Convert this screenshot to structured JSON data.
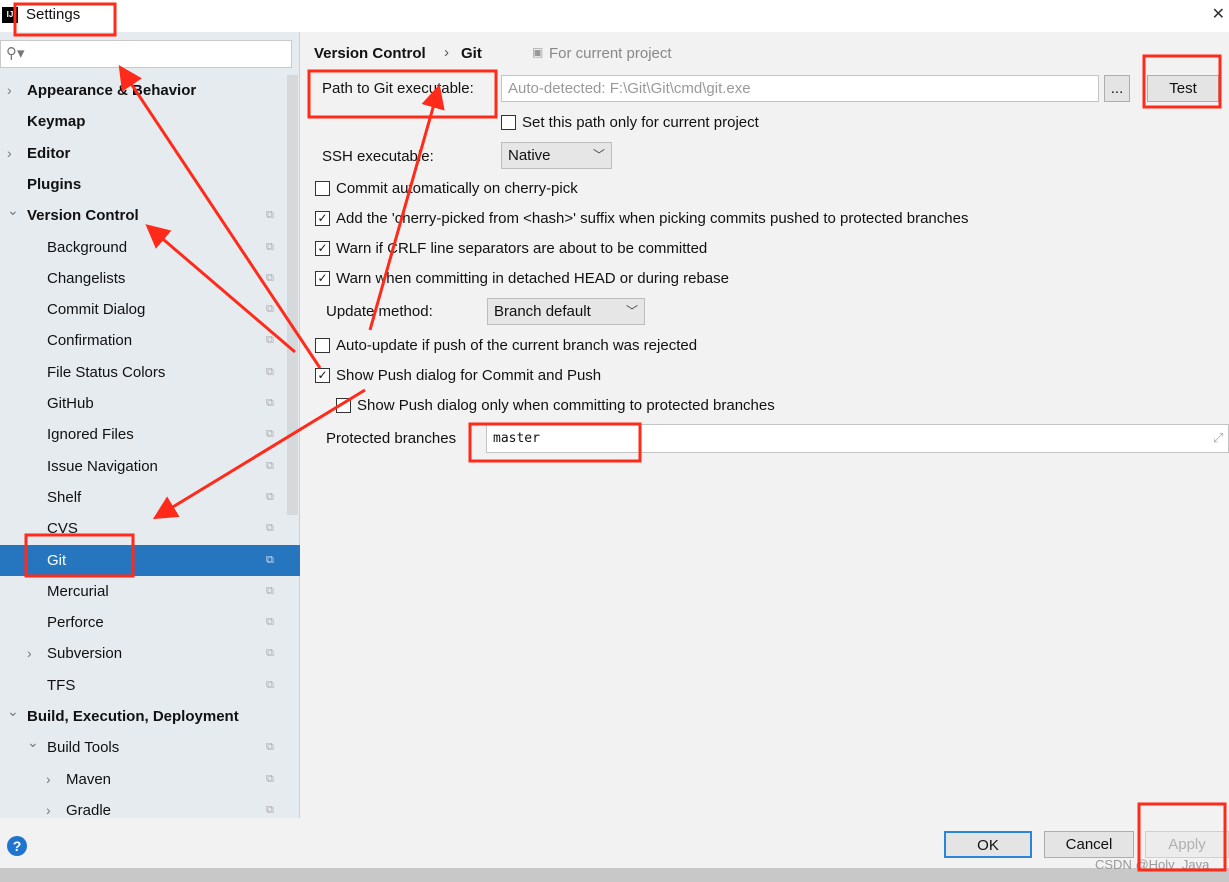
{
  "window": {
    "title": "Settings",
    "close": "✕"
  },
  "sidebar": {
    "search_placeholder": "",
    "items": [
      {
        "label": "Appearance & Behavior",
        "level": 0,
        "bold": true,
        "expandable": true,
        "expanded": false
      },
      {
        "label": "Keymap",
        "level": 0,
        "bold": true
      },
      {
        "label": "Editor",
        "level": 0,
        "bold": true,
        "expandable": true,
        "expanded": false
      },
      {
        "label": "Plugins",
        "level": 0,
        "bold": true
      },
      {
        "label": "Version Control",
        "level": 0,
        "bold": true,
        "expandable": true,
        "expanded": true,
        "copy": true
      },
      {
        "label": "Background",
        "level": 1,
        "copy": true
      },
      {
        "label": "Changelists",
        "level": 1,
        "copy": true
      },
      {
        "label": "Commit Dialog",
        "level": 1,
        "copy": true
      },
      {
        "label": "Confirmation",
        "level": 1,
        "copy": true
      },
      {
        "label": "File Status Colors",
        "level": 1,
        "copy": true
      },
      {
        "label": "GitHub",
        "level": 1,
        "copy": true
      },
      {
        "label": "Ignored Files",
        "level": 1,
        "copy": true
      },
      {
        "label": "Issue Navigation",
        "level": 1,
        "copy": true
      },
      {
        "label": "Shelf",
        "level": 1,
        "copy": true
      },
      {
        "label": "CVS",
        "level": 1,
        "copy": true
      },
      {
        "label": "Git",
        "level": 1,
        "copy": true,
        "selected": true
      },
      {
        "label": "Mercurial",
        "level": 1,
        "copy": true
      },
      {
        "label": "Perforce",
        "level": 1,
        "copy": true
      },
      {
        "label": "Subversion",
        "level": 1,
        "copy": true,
        "expandable": true,
        "expanded": false
      },
      {
        "label": "TFS",
        "level": 1,
        "copy": true
      },
      {
        "label": "Build, Execution, Deployment",
        "level": 0,
        "bold": true,
        "expandable": true,
        "expanded": true
      },
      {
        "label": "Build Tools",
        "level": 1,
        "copy": true,
        "expandable": true,
        "expanded": true
      },
      {
        "label": "Maven",
        "level": 2,
        "copy": true,
        "expandable": true,
        "expanded": false
      },
      {
        "label": "Gradle",
        "level": 2,
        "copy": true,
        "expandable": true,
        "expanded": false
      }
    ]
  },
  "main": {
    "breadcrumb": [
      "Version Control",
      "Git"
    ],
    "scope": "For current project",
    "path_label": "Path to Git executable:",
    "path_placeholder": "Auto-detected: F:\\Git\\Git\\cmd\\git.exe",
    "browse": "...",
    "test": "Test",
    "set_path_only": {
      "label": "Set this path only for current project",
      "checked": false
    },
    "ssh_label": "SSH executable:",
    "ssh_value": "Native",
    "checks": [
      {
        "label": "Commit automatically on cherry-pick",
        "checked": false
      },
      {
        "label": "Add the 'cherry-picked from <hash>' suffix when picking commits pushed to protected branches",
        "checked": true
      },
      {
        "label": "Warn if CRLF line separators are about to be committed",
        "checked": true
      },
      {
        "label": "Warn when committing in detached HEAD or during rebase",
        "checked": true
      }
    ],
    "update_label": "Update method:",
    "update_value": "Branch default",
    "checks2": [
      {
        "label": "Auto-update if push of the current branch was rejected",
        "checked": false
      },
      {
        "label": "Show Push dialog for Commit and Push",
        "checked": true
      },
      {
        "label": "Show Push dialog only when committing to protected branches",
        "checked": false
      }
    ],
    "protected_label": "Protected branches",
    "protected_value": "master"
  },
  "footer": {
    "help": "?",
    "ok": "OK",
    "cancel": "Cancel",
    "apply": "Apply",
    "watermark": "CSDN @Holy_Java"
  },
  "colors": {
    "selection": "#2675bf",
    "annotation": "#ff2a1a"
  }
}
